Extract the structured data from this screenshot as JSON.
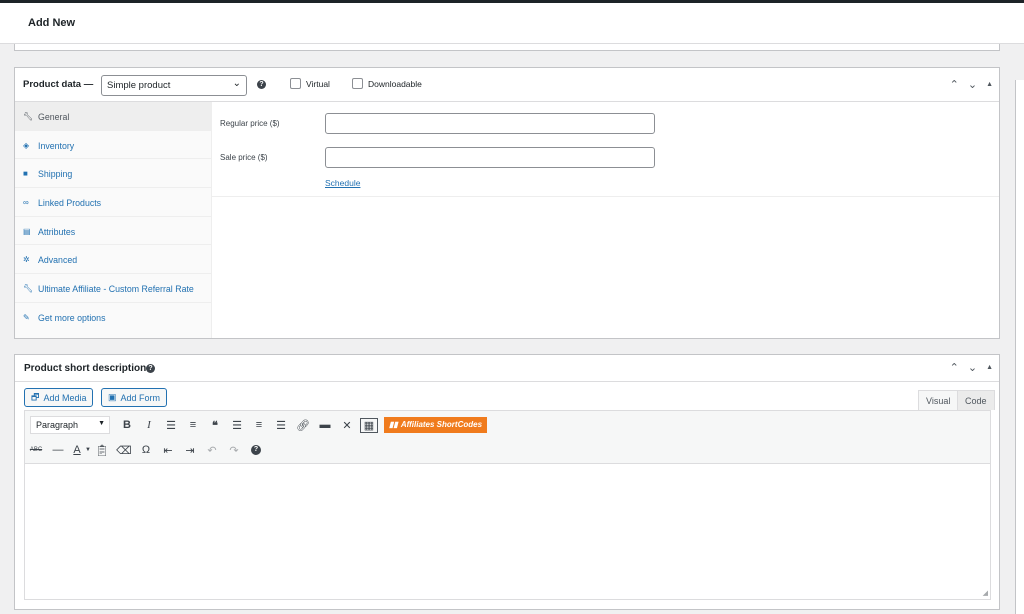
{
  "header": {
    "title": "Add New"
  },
  "product_data": {
    "label": "Product data —",
    "type_select": {
      "value": "Simple product"
    },
    "virtual_label": "Virtual",
    "downloadable_label": "Downloadable",
    "tabs": [
      {
        "label": "General",
        "icon": "wrench-icon"
      },
      {
        "label": "Inventory",
        "icon": "tag-icon"
      },
      {
        "label": "Shipping",
        "icon": "truck-icon"
      },
      {
        "label": "Linked Products",
        "icon": "link-icon"
      },
      {
        "label": "Attributes",
        "icon": "table-icon"
      },
      {
        "label": "Advanced",
        "icon": "gear-icon"
      },
      {
        "label": "Ultimate Affiliate - Custom Referral Rate",
        "icon": "wrench-icon"
      },
      {
        "label": "Get more options",
        "icon": "plugin-icon"
      }
    ],
    "regular_price_label": "Regular price ($)",
    "regular_price_value": "",
    "sale_price_label": "Sale price ($)",
    "sale_price_value": "",
    "schedule_link": "Schedule"
  },
  "short_description": {
    "title": "Product short description",
    "add_media": "Add Media",
    "add_form": "Add Form",
    "tab_visual": "Visual",
    "tab_code": "Code",
    "format_select": "Paragraph",
    "affiliates_button": "Affiliates ShortCodes",
    "content": ""
  }
}
